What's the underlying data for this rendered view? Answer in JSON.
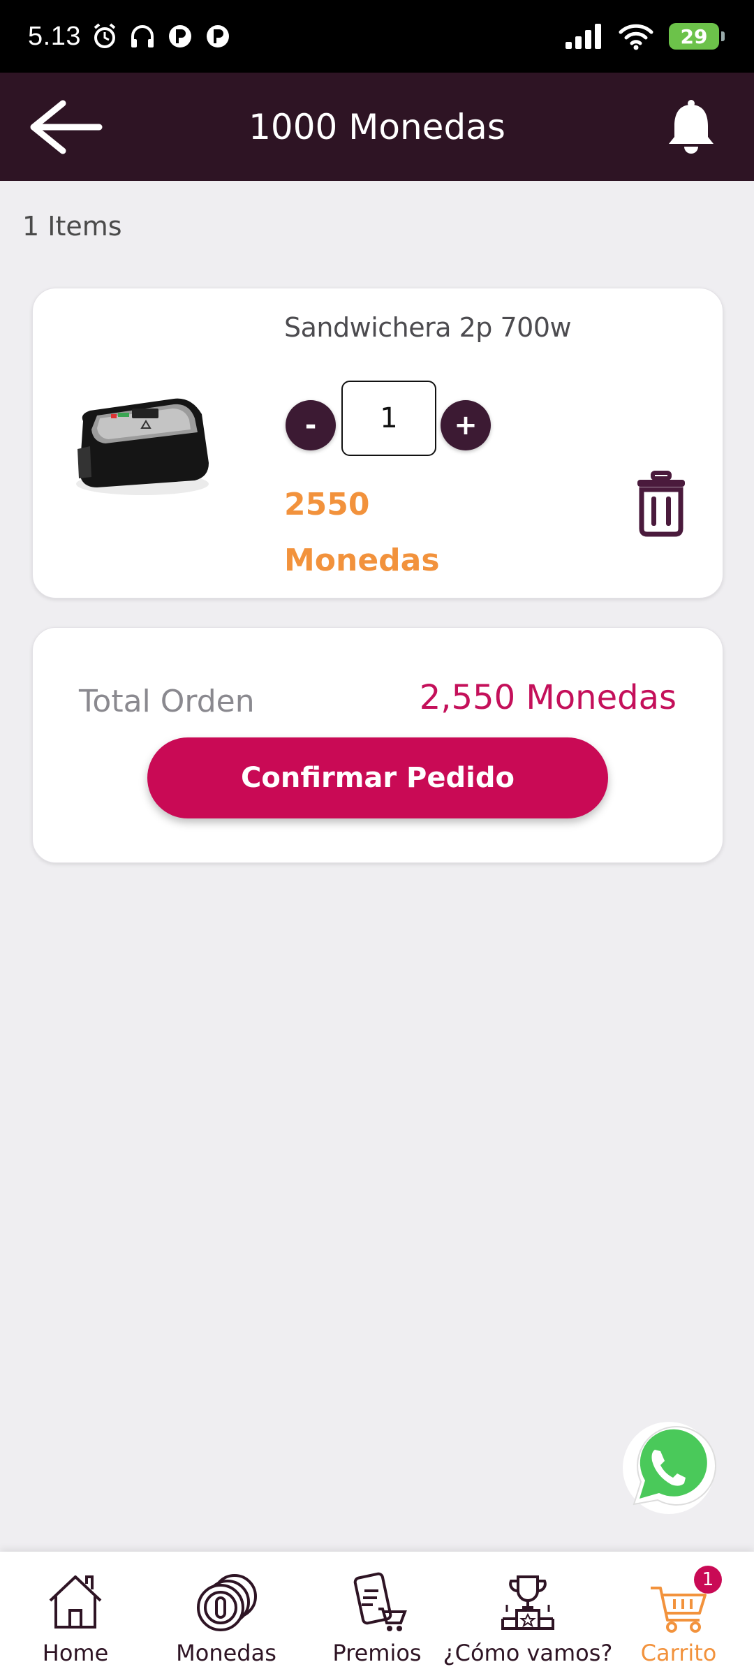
{
  "status_bar": {
    "time": "5.13",
    "battery": "29"
  },
  "header": {
    "title": "1000 Monedas"
  },
  "cart": {
    "items_count": "1 Items",
    "product": {
      "name": "Sandwichera 2p 700w",
      "quantity": "1",
      "minus_label": "-",
      "plus_label": "+",
      "price_value": "2550",
      "price_unit": "Monedas"
    },
    "total": {
      "label": "Total Orden",
      "value": "2,550 Monedas",
      "confirm_label": "Confirmar Pedido"
    }
  },
  "bottom_nav": {
    "items": [
      {
        "label": "Home",
        "icon": "home-icon"
      },
      {
        "label": "Monedas",
        "icon": "coins-icon"
      },
      {
        "label": "Premios",
        "icon": "prizes-icon"
      },
      {
        "label": "¿Cómo vamos?",
        "icon": "trophy-icon"
      },
      {
        "label": "Carrito",
        "icon": "cart-icon"
      }
    ],
    "cart_badge": "1"
  },
  "colors": {
    "header_bg": "#2e1424",
    "accent_orange": "#f2923c",
    "accent_magenta": "#c90a55",
    "qty_button": "#3c1a33"
  }
}
